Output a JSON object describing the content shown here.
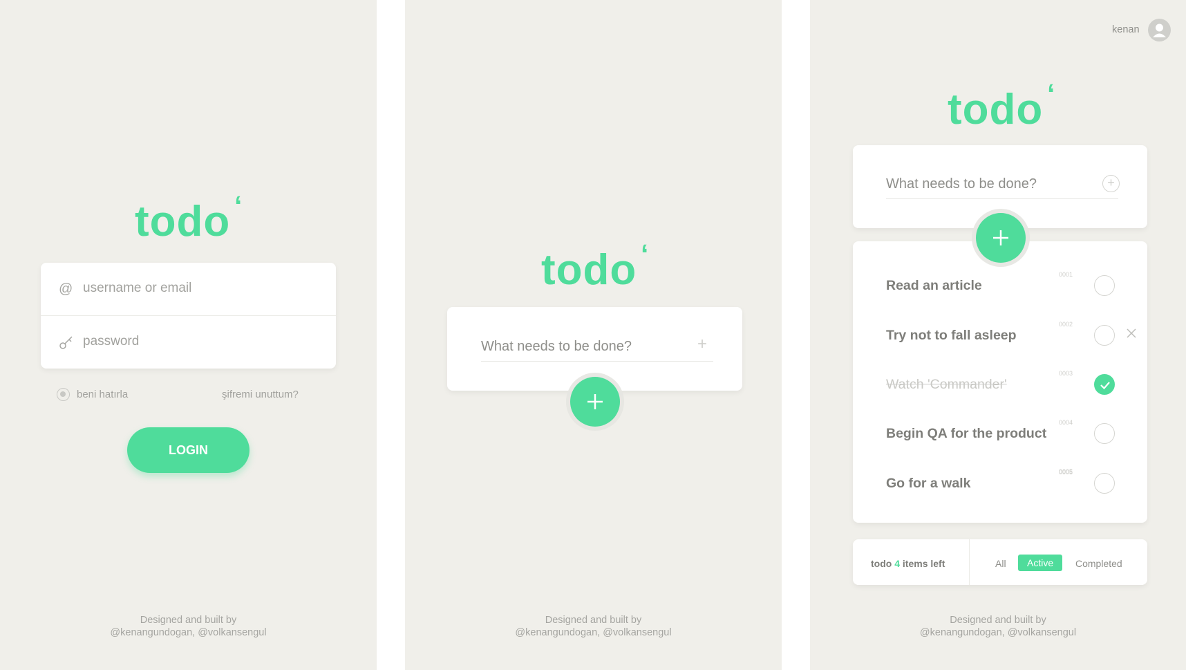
{
  "brand": {
    "logo": "todo",
    "accent": "#4fdc9b",
    "background": "#f0efea"
  },
  "login": {
    "username_placeholder": "username or email",
    "password_placeholder": "password",
    "remember_label": "beni hatırla",
    "forgot_link": "şifremi unuttum?",
    "login_button": "LOGIN",
    "icons": {
      "username": "at-sign-icon",
      "password": "key-icon"
    }
  },
  "empty": {
    "input_placeholder": "What needs to be done?"
  },
  "list": {
    "user_name": "kenan",
    "input_placeholder": "What needs to be done?",
    "items": [
      {
        "label": "Read an article",
        "num": "0001",
        "done": false
      },
      {
        "label": "Try not to fall asleep",
        "num": "0002",
        "done": false
      },
      {
        "label": "Watch 'Commander'",
        "num": "0003",
        "done": true
      },
      {
        "label": "Begin QA for the product",
        "num": "0004",
        "done": false
      },
      {
        "label": "Go for a walk",
        "num": "0005",
        "done": false
      }
    ],
    "extra_num": "0005",
    "status": {
      "prefix": "todo",
      "count": "4",
      "suffix": "items left"
    },
    "filters": {
      "all": "All",
      "active": "Active",
      "completed": "Completed"
    }
  },
  "footer": {
    "line1": "Designed and built by",
    "line2": "@kenangundogan, @volkansengul"
  }
}
